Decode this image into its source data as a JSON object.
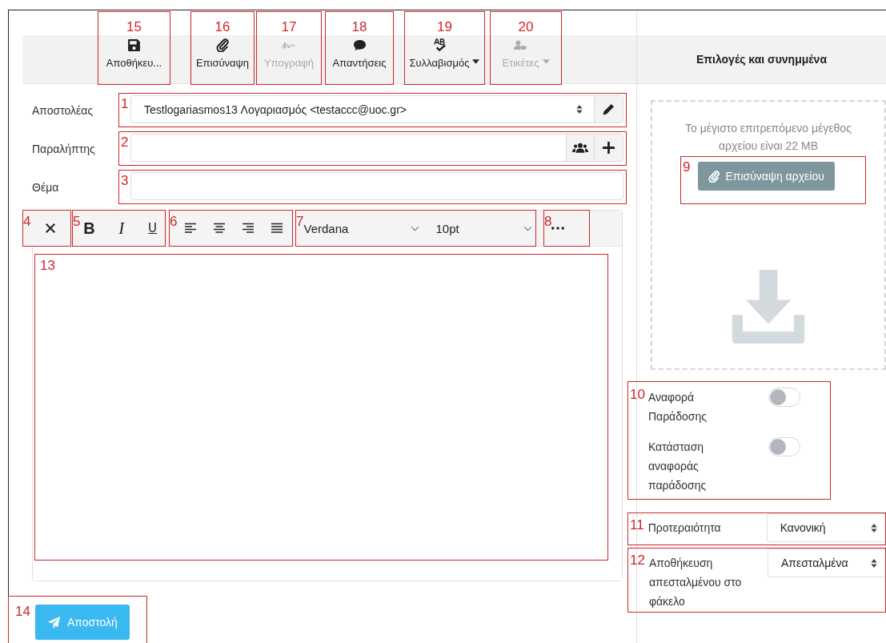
{
  "toolbar": {
    "buttons": [
      {
        "kind": "save",
        "label": "Αποθήκευ...",
        "disabled": false,
        "dropdown": false,
        "annotation": "15"
      },
      {
        "kind": "attach",
        "label": "Επισύναψη",
        "disabled": false,
        "dropdown": false,
        "annotation": "16"
      },
      {
        "kind": "signature",
        "label": "Υπογραφή",
        "disabled": true,
        "dropdown": false,
        "annotation": "17"
      },
      {
        "kind": "replies",
        "label": "Απαντήσεις",
        "disabled": false,
        "dropdown": false,
        "annotation": "18"
      },
      {
        "kind": "spelling",
        "label": "Συλλαβισμός",
        "disabled": false,
        "dropdown": true,
        "annotation": "19"
      },
      {
        "kind": "tags",
        "label": "Ετικέτες",
        "disabled": true,
        "dropdown": true,
        "annotation": "20"
      }
    ]
  },
  "form": {
    "fields": [
      {
        "label": "Αποστολέας",
        "kind": "select",
        "value": "Testlogariasmos13 Λογαριασμός <testaccc@uoc.gr>",
        "annotation": "1"
      },
      {
        "label": "Παραλήπτης",
        "kind": "recipients",
        "annotation": "2"
      },
      {
        "label": "Θέμα",
        "kind": "text",
        "annotation": "3"
      }
    ]
  },
  "editor": {
    "groups": [
      {
        "kind": "clear",
        "annotation": "4"
      },
      {
        "kind": "style",
        "buttons": [
          "B",
          "I",
          "U"
        ],
        "annotation": "5"
      },
      {
        "kind": "align",
        "annotation": "6"
      },
      {
        "kind": "font",
        "font": "Verdana",
        "size": "10pt",
        "annotation": "7"
      },
      {
        "kind": "more",
        "annotation": "8"
      }
    ],
    "body_annotation": "13"
  },
  "send": {
    "label": "Αποστολή",
    "annotation": "14"
  },
  "options_panel": {
    "title": "Επιλογές και συνημμένα",
    "dropzone": {
      "note": "Το μέγιστο επιτρεπόμενο μέγεθος αρχείου είναι 22 MB",
      "button": "Επισύναψη αρχείου",
      "annotation": "9"
    },
    "toggles": {
      "annotation": "10",
      "items": [
        {
          "label": "Αναφορά Παράδοσης",
          "on": false
        },
        {
          "label": "Κατάσταση αναφοράς παράδοσης",
          "on": false
        }
      ]
    },
    "selects": [
      {
        "label": "Προτεραιότητα",
        "value": "Κανονική",
        "annotation": "11"
      },
      {
        "label": "Αποθήκευση απεσταλμένου στο φάκελο",
        "value": "Απεσταλμένα",
        "annotation": "12"
      }
    ]
  }
}
